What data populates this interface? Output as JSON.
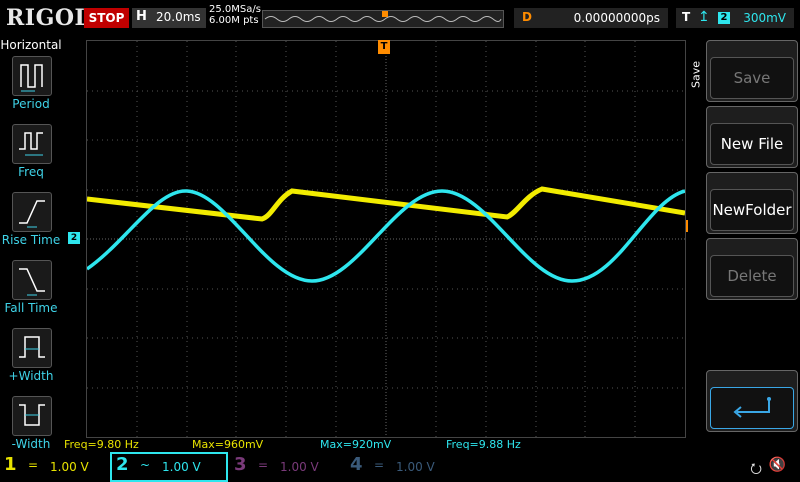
{
  "header": {
    "logo": "RIGOL",
    "run_state": "STOP",
    "timebase_label": "H",
    "timebase_value": "20.0ms",
    "sample_rate": "25.0MSa/s",
    "memory_depth": "6.00M pts",
    "trigger_marker": "T",
    "delay_label": "D",
    "delay_value": "0.00000000ps",
    "trigger_label": "T",
    "trigger_edge_icon": "rising-edge-icon",
    "trigger_source": "2",
    "trigger_level": "300mV"
  },
  "left_menu": {
    "title": "Horizontal",
    "items": [
      {
        "label": "Period",
        "icon": "period-icon"
      },
      {
        "label": "Freq",
        "icon": "freq-icon"
      },
      {
        "label": "Rise Time",
        "icon": "rise-time-icon"
      },
      {
        "label": "Fall Time",
        "icon": "fall-time-icon"
      },
      {
        "label": "+Width",
        "icon": "positive-width-icon"
      },
      {
        "label": "-Width",
        "icon": "negative-width-icon"
      }
    ]
  },
  "channel_marker": "2",
  "trigger_position_marker": "T",
  "measurements": [
    {
      "text": "Freq=9.80 Hz",
      "color": "#e8e300"
    },
    {
      "text": "Max=960mV",
      "color": "#e8e300"
    },
    {
      "text": "Max=920mV",
      "color": "#2ee6ee"
    },
    {
      "text": "Freq=9.88 Hz",
      "color": "#2ee6ee"
    }
  ],
  "right_menu": {
    "group_label": "Save",
    "buttons": [
      {
        "label": "Save",
        "state": "disabled"
      },
      {
        "label": "New File",
        "state": "active"
      },
      {
        "label": "NewFolder",
        "state": "active"
      },
      {
        "label": "Delete",
        "state": "disabled"
      }
    ],
    "back_icon": "return-arrow-icon"
  },
  "channels": [
    {
      "num": "1",
      "coupling": "=",
      "scale": "1.00 V",
      "color": "#e8e300"
    },
    {
      "num": "2",
      "coupling": "~",
      "scale": "1.00 V",
      "color": "#2ee6ee"
    },
    {
      "num": "3",
      "coupling": "=",
      "scale": "1.00 V",
      "color": "#7a3a7a"
    },
    {
      "num": "4",
      "coupling": "=",
      "scale": "1.00 V",
      "color": "#3a5a7a"
    }
  ],
  "status_icons": {
    "usb": "usb-icon",
    "speaker": "speaker-muted-icon"
  }
}
